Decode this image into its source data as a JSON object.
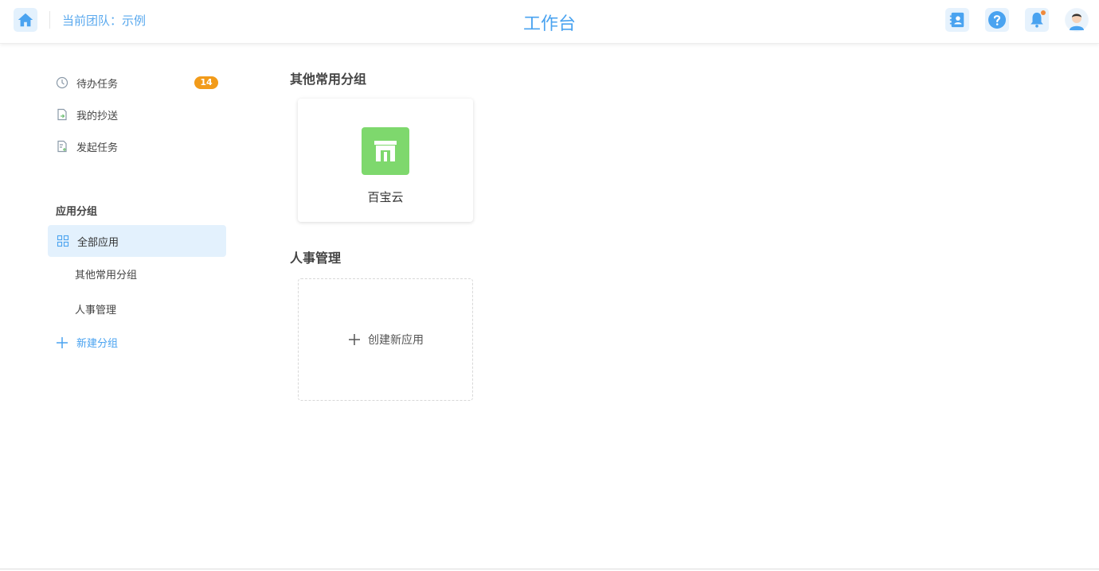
{
  "header": {
    "team_label": "当前团队：示例",
    "title": "工作台"
  },
  "sidebar": {
    "items": [
      {
        "label": "待办任务",
        "badge": "14"
      },
      {
        "label": "我的抄送"
      },
      {
        "label": "发起任务"
      }
    ],
    "section_label": "应用分组",
    "all_apps": "全部应用",
    "groups": [
      "其他常用分组",
      "人事管理"
    ],
    "new_group": "新建分组"
  },
  "main": {
    "groups": [
      {
        "title": "其他常用分组",
        "apps": [
          {
            "name": "百宝云",
            "icon": "storefront-icon"
          }
        ]
      },
      {
        "title": "人事管理",
        "create_label": "创建新应用"
      }
    ]
  },
  "colors": {
    "accent": "#4aa3f0",
    "badge": "#f29b1a",
    "app_icon_bg": "#7ed86d",
    "active_bg": "#e3f1fd"
  }
}
